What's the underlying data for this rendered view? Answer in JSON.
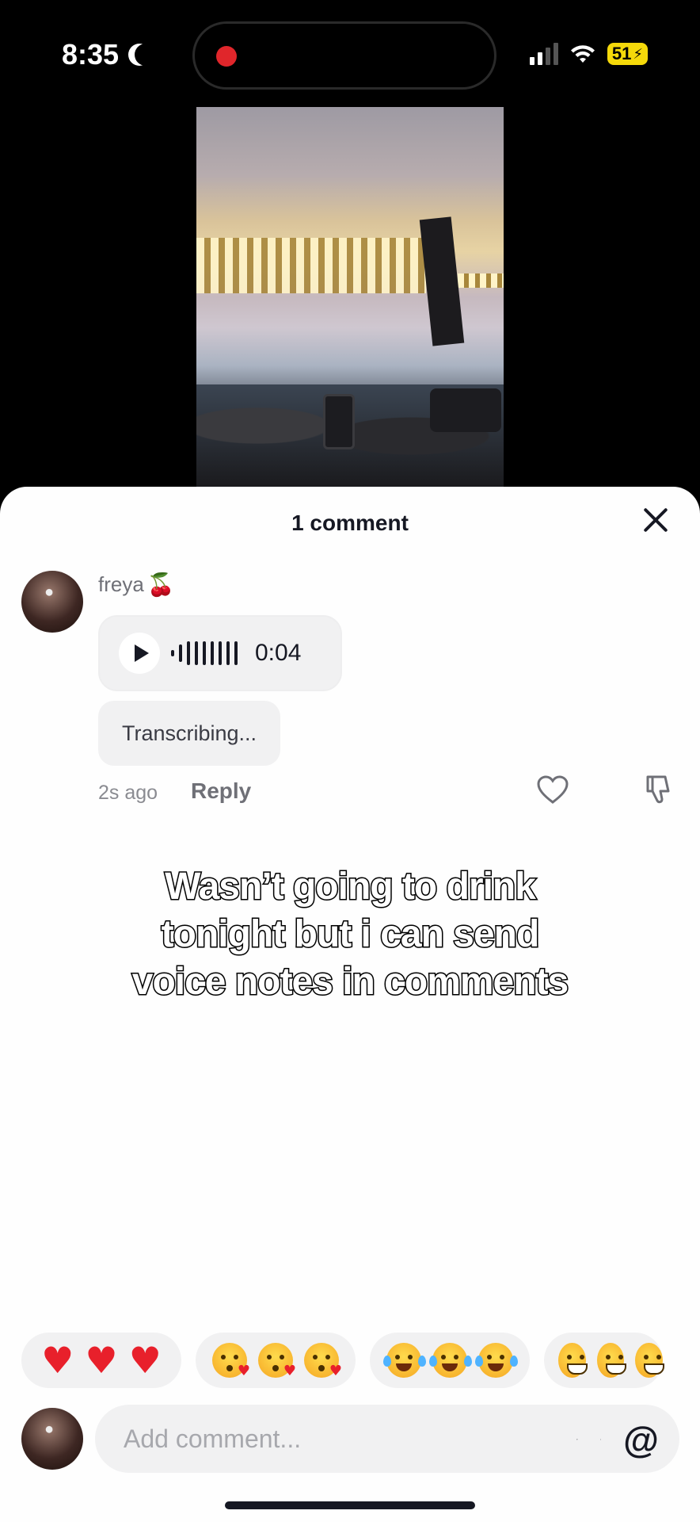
{
  "status_bar": {
    "time": "8:35",
    "battery": "51",
    "icons": [
      "moon-icon",
      "signal-icon",
      "wifi-icon",
      "battery-icon"
    ],
    "recording_indicator_color": "#e0262b"
  },
  "comments_sheet": {
    "title": "1 comment",
    "comments": [
      {
        "username": "freya",
        "username_emoji": "🍒",
        "voice_note_duration": "0:04",
        "transcription": "Transcribing...",
        "time_ago": "2s ago",
        "reply_label": "Reply"
      }
    ]
  },
  "caption": {
    "lines": [
      "Wasn’t going to drink",
      "tonight but i can send",
      "voice notes in comments"
    ]
  },
  "quick_reactions": [
    {
      "emoji": "heart",
      "count": 3
    },
    {
      "emoji": "kissing-heart",
      "count": 3
    },
    {
      "emoji": "joy",
      "count": 3
    },
    {
      "emoji": "grin",
      "count": 3
    }
  ],
  "comment_input": {
    "placeholder": "Add comment..."
  },
  "colors": {
    "text_primary": "#161823",
    "text_secondary": "#8a8b91",
    "chip_bg": "#f1f1f2",
    "battery": "#f5d90a"
  }
}
